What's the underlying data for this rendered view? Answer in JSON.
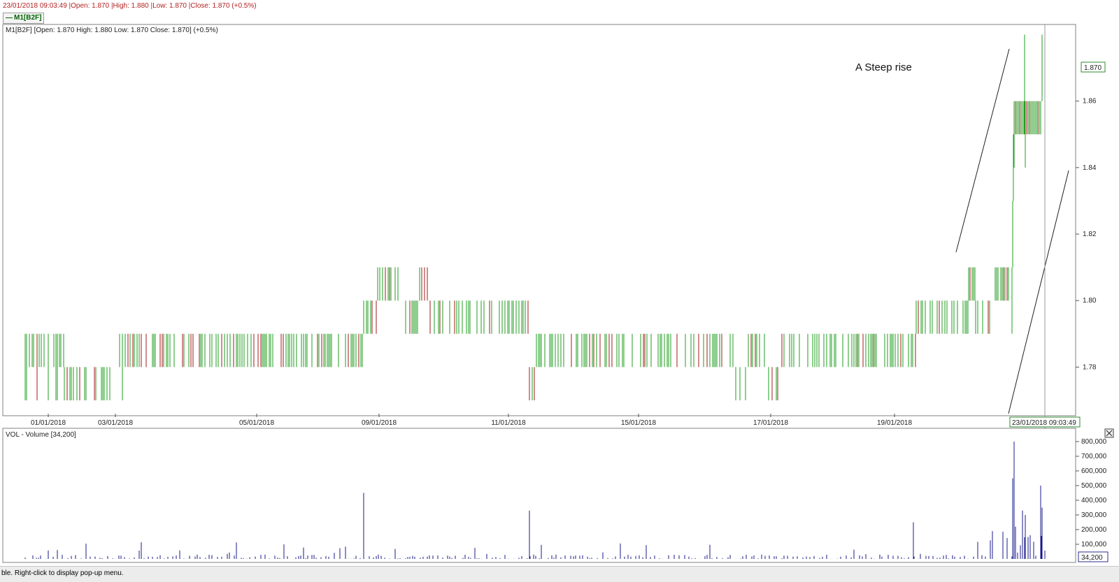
{
  "header": {
    "info_line": "23/01/2018 09:03:49 |Open: 1.870 |High: 1.880 |Low: 1.870 |Close: 1.870 (+0.5%)",
    "tab_label": "M1[B2F]"
  },
  "price_panel": {
    "caption": "M1[B2F] [Open: 1.870  High: 1.880  Low: 1.870  Close: 1.870] (+0.5%)",
    "annotation": "A Steep rise",
    "last_price_label": "1.870",
    "crosshair_time_label": "23/01/2018 09:03:49"
  },
  "volume_panel": {
    "caption": "VOL - Volume [34,200]",
    "last_volume_label": "34,200",
    "close_icon": "close-icon"
  },
  "status_bar": {
    "text": "ble. Right-click to display pop-up menu."
  },
  "colors": {
    "up": "#1f9e1f",
    "down": "#a01818",
    "volume": "#1a1a8c",
    "axis_text": "#222222",
    "info_text": "#b22222"
  },
  "chart_data": [
    {
      "type": "ohlc",
      "title": "M1[B2F]",
      "ylim": [
        1.766,
        1.882
      ],
      "y_ticks": [
        "1.78",
        "1.80",
        "1.82",
        "1.84",
        "1.86",
        "1.870"
      ],
      "x_tick_labels": [
        "01/01/2018",
        "03/01/2018",
        "05/01/2018",
        "09/01/2018",
        "11/01/2018",
        "15/01/2018",
        "17/01/2018",
        "19/01/2018"
      ],
      "price_levels": [
        {
          "segment": "01/01-02/01",
          "range": [
            1.77,
            1.79
          ]
        },
        {
          "segment": "03/01",
          "range": [
            1.77,
            1.79
          ]
        },
        {
          "segment": "04/01-08/01",
          "range": [
            1.78,
            1.79
          ]
        },
        {
          "segment": "09/01-10/01",
          "range": [
            1.79,
            1.81
          ]
        },
        {
          "segment": "10/01-11/01",
          "range": [
            1.79,
            1.8
          ]
        },
        {
          "segment": "12/01-16/01",
          "range": [
            1.78,
            1.79
          ]
        },
        {
          "segment": "17/01",
          "range": [
            1.77,
            1.79
          ]
        },
        {
          "segment": "18/01-19/01",
          "range": [
            1.78,
            1.79
          ]
        },
        {
          "segment": "20/01-22/01",
          "range": [
            1.79,
            1.81
          ]
        },
        {
          "segment": "23/01",
          "range": [
            1.79,
            1.88
          ]
        }
      ],
      "last": {
        "open": 1.87,
        "high": 1.88,
        "low": 1.87,
        "close": 1.87
      }
    },
    {
      "type": "bar",
      "title": "VOL - Volume",
      "ylim": [
        0,
        800000
      ],
      "y_ticks": [
        "100,000",
        "200,000",
        "300,000",
        "400,000",
        "500,000",
        "600,000",
        "700,000",
        "800,000"
      ],
      "notable_spikes": [
        {
          "near": "08/01/2018",
          "value": 450000
        },
        {
          "near": "11/01/2018",
          "value": 330000
        },
        {
          "near": "20/01/2018",
          "value": 250000
        },
        {
          "near": "23/01/2018",
          "value": 800000
        }
      ],
      "last_value": 34200
    }
  ]
}
